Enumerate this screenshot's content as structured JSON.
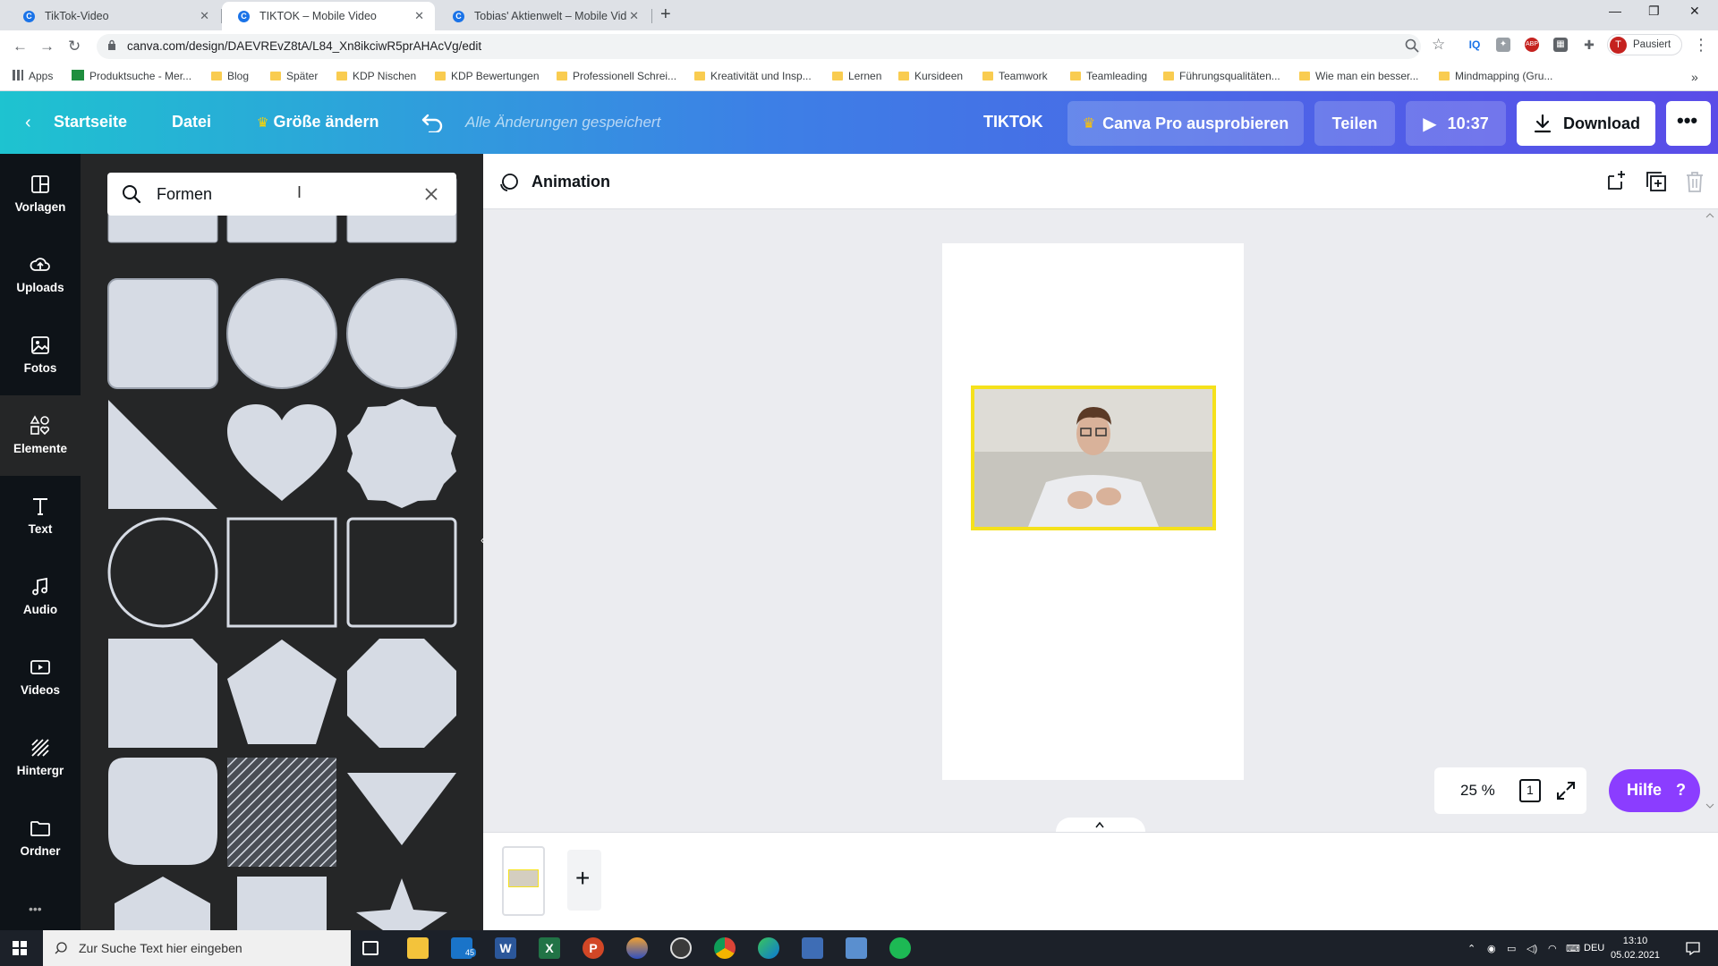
{
  "browser": {
    "tabs": [
      {
        "title": "TikTok-Video",
        "active": false
      },
      {
        "title": "TIKTOK – Mobile Video",
        "active": true
      },
      {
        "title": "Tobias' Aktienwelt – Mobile Vide",
        "active": false
      }
    ],
    "url": "canva.com/design/DAEVREvZ8tA/L84_Xn8ikciwR5prAHAcVg/edit",
    "profile_label": "Pausiert",
    "profile_initial": "T",
    "bookmarks": [
      "Apps",
      "Produktsuche - Mer...",
      "Blog",
      "Später",
      "KDP Nischen",
      "KDP Bewertungen",
      "Professionell Schrei...",
      "Kreativität und Insp...",
      "Lernen",
      "Kursideen",
      "Teamwork",
      "Teamleading",
      "Führungsqualitäten...",
      "Wie man ein besser...",
      "Mindmapping  (Gru..."
    ]
  },
  "canva": {
    "header": {
      "home": "Startseite",
      "file": "Datei",
      "resize": "Größe ändern",
      "saved_status": "Alle Änderungen gespeichert",
      "design_title": "TIKTOK",
      "pro": "Canva Pro ausprobieren",
      "share": "Teilen",
      "play_duration": "10:37",
      "download": "Download"
    },
    "rail": [
      "Vorlagen",
      "Uploads",
      "Fotos",
      "Elemente",
      "Text",
      "Audio",
      "Videos",
      "Hintergr",
      "Ordner"
    ],
    "rail_active": "Elemente",
    "search": {
      "query": "Formen"
    },
    "toolbar": {
      "animation": "Animation"
    },
    "zoom": "25 %",
    "page_count": "1",
    "help": "Hilfe",
    "help_icon": "?"
  },
  "taskbar": {
    "search_placeholder": "Zur Suche Text hier eingeben",
    "mail_badge": "45",
    "language": "DEU",
    "time": "13:10",
    "date": "05.02.2021"
  },
  "colors": {
    "accent_purple": "#8b3dff",
    "selection_yellow": "#f5e11b",
    "shape_fill": "#d6dbe4"
  }
}
